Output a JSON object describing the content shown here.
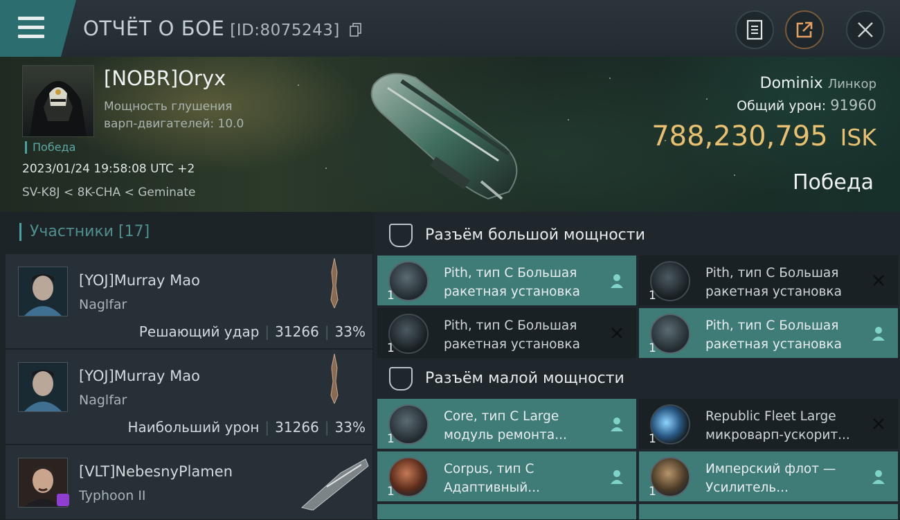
{
  "header": {
    "title": "ОТЧЁТ О БОЕ",
    "report_id": "[ID:8075243]"
  },
  "victim": {
    "pilot": "[NOBR]Oryx",
    "stat_line1": "Мощность глушения",
    "stat_line2": "варп-двигателей: 10.0",
    "result_small": "Победа",
    "datetime": "2023/01/24 19:58:08 UTC +2",
    "location": "SV-K8J < 8K-CHA < Geminate",
    "ship_name": "Dominix",
    "ship_class": "Линкор",
    "damage_label": "Общий урон:",
    "damage_value": "91960",
    "isk_value": "788,230,795",
    "isk_unit": "ISK",
    "result_big": "Победа"
  },
  "participants": {
    "header": "Участники [17]",
    "items": [
      {
        "name": "[YOJ]Murray Mao",
        "ship": "Naglfar",
        "role": "Решающий удар",
        "damage": "31266",
        "percent": "33%"
      },
      {
        "name": "[YOJ]Murray Mao",
        "ship": "Naglfar",
        "role": "Наибольший урон",
        "damage": "31266",
        "percent": "33%"
      },
      {
        "name": "[VLT]NebesnyPlamen",
        "ship": "Typhoon II"
      }
    ]
  },
  "fitting": {
    "high_slots": {
      "title": "Разъём большой мощности",
      "modules": [
        {
          "line1": "Pith, тип C Большая",
          "line2": "ракетная установка",
          "qty": "1",
          "status": "dropped"
        },
        {
          "line1": "Pith, тип C Большая",
          "line2": "ракетная установка",
          "qty": "1",
          "status": "destroyed"
        },
        {
          "line1": "Pith, тип C Большая",
          "line2": "ракетная установка",
          "qty": "1",
          "status": "destroyed"
        },
        {
          "line1": "Pith, тип C Большая",
          "line2": "ракетная установка",
          "qty": "1",
          "status": "dropped"
        }
      ]
    },
    "low_slots": {
      "title": "Разъём малой мощности",
      "modules": [
        {
          "line1": "Core, тип C Large",
          "line2": "модуль ремонта...",
          "qty": "1",
          "status": "dropped"
        },
        {
          "line1": "Republic Fleet Large",
          "line2": "микроварп-ускорит...",
          "qty": "1",
          "status": "destroyed"
        },
        {
          "line1": "Corpus, тип C",
          "line2": "Адаптивный...",
          "qty": "1",
          "status": "dropped"
        },
        {
          "line1": "Имперский флот —",
          "line2": "Усилитель...",
          "qty": "1",
          "status": "dropped"
        }
      ]
    }
  }
}
